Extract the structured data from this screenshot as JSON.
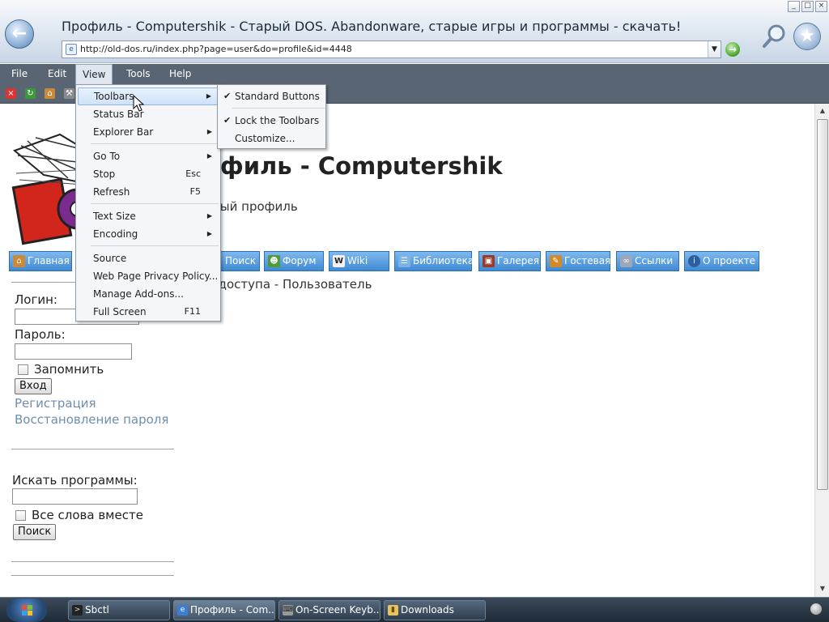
{
  "window": {
    "title": "Профиль - Computershik - Старый DOS. Abandonware, старые игры и программы - скачать!",
    "address": "http://old-dos.ru/index.php?page=user&do=profile&id=4448",
    "controls": [
      "_",
      "□",
      "×"
    ]
  },
  "menubar": [
    {
      "label": "File"
    },
    {
      "label": "Edit"
    },
    {
      "label": "View"
    },
    {
      "label": "Tools"
    },
    {
      "label": "Help"
    }
  ],
  "view_menu": {
    "items": [
      {
        "label": "Toolbars",
        "shortcut": "",
        "submenu": true
      },
      {
        "label": "Status Bar",
        "shortcut": "",
        "submenu": false
      },
      {
        "label": "Explorer Bar",
        "shortcut": "",
        "submenu": true
      },
      {
        "label": "Go To",
        "shortcut": "",
        "submenu": true
      },
      {
        "label": "Stop",
        "shortcut": "Esc",
        "submenu": false
      },
      {
        "label": "Refresh",
        "shortcut": "F5",
        "submenu": false
      },
      {
        "label": "Text Size",
        "shortcut": "",
        "submenu": true
      },
      {
        "label": "Encoding",
        "shortcut": "",
        "submenu": true
      },
      {
        "label": "Source",
        "shortcut": "",
        "submenu": false
      },
      {
        "label": "Web Page Privacy Policy...",
        "shortcut": "",
        "submenu": false
      },
      {
        "label": "Manage Add-ons...",
        "shortcut": "",
        "submenu": false
      },
      {
        "label": "Full Screen",
        "shortcut": "F11",
        "submenu": false
      }
    ]
  },
  "toolbars_submenu": {
    "items": [
      {
        "label": "Standard Buttons",
        "checked": true
      },
      {
        "label": "Lock the Toolbars",
        "checked": true
      },
      {
        "label": "Customize...",
        "checked": false
      }
    ]
  },
  "page": {
    "heading": "офиль - Computershik",
    "subheading": "ный профиль",
    "access_text": "ь доступа - Пользователь",
    "nav": [
      {
        "label": "Главная",
        "icon": "home-icon"
      },
      {
        "label": "Поиск",
        "icon": "search-icon"
      },
      {
        "label": "Форум",
        "icon": "user-icon"
      },
      {
        "label": "Wiki",
        "icon": "wiki-icon"
      },
      {
        "label": "Библиотека",
        "icon": "book-icon"
      },
      {
        "label": "Галерея",
        "icon": "picture-icon"
      },
      {
        "label": "Гостевая",
        "icon": "guestbook-icon"
      },
      {
        "label": "Ссылки",
        "icon": "link-icon"
      },
      {
        "label": "О проекте",
        "icon": "info-icon"
      }
    ],
    "login": {
      "login_label": "Логин:",
      "login_value": "",
      "password_label": "Пароль:",
      "password_value": "",
      "remember_label": "Запомнить",
      "submit_label": "Вход",
      "register_link": "Регистрация",
      "restore_link": "Восстановление пароля"
    },
    "search": {
      "label": "Искать программы:",
      "value": "",
      "all_words_label": "Все слова вместе",
      "submit_label": "Поиск"
    }
  },
  "taskbar": {
    "buttons": [
      {
        "label": "Sbctl",
        "icon": "terminal-icon"
      },
      {
        "label": "Профиль - Com...",
        "icon": "ie-icon"
      },
      {
        "label": "On-Screen Keyb...",
        "icon": "keyboard-icon"
      },
      {
        "label": "Downloads",
        "icon": "folder-icon"
      }
    ]
  },
  "colors": {
    "menubar_bg": "#5a6573",
    "nav_button": "#3f8ad2",
    "link": "#6d8fad"
  }
}
